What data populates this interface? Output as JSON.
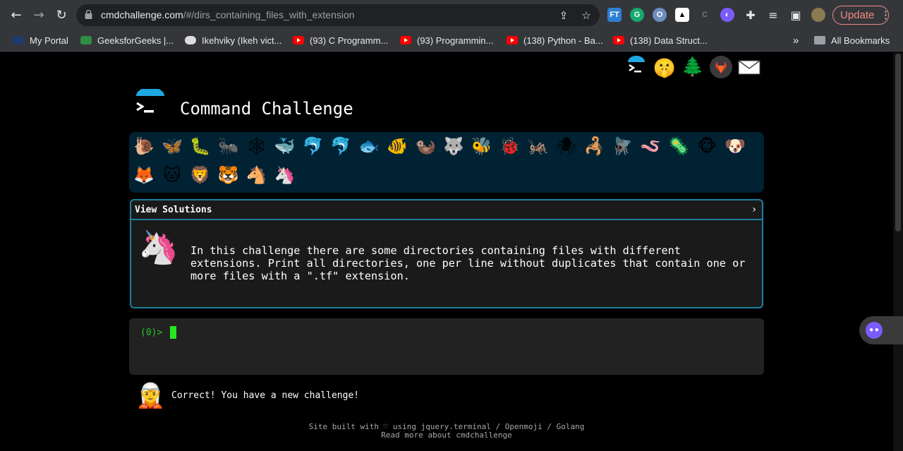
{
  "browser": {
    "url_host": "cmdchallenge.com",
    "url_path": "/#/dirs_containing_files_with_extension",
    "update_label": "Update",
    "extensions": [
      "FT",
      "G",
      "O",
      "▲",
      "C",
      "◐"
    ],
    "bookmarks": [
      {
        "label": "My Portal",
        "icon": "portal-icon"
      },
      {
        "label": "GeeksforGeeks |...",
        "icon": "geeksforgeeks-icon"
      },
      {
        "label": "Ikehviky (Ikeh vict...",
        "icon": "github-icon"
      },
      {
        "label": "(93) C Programm...",
        "icon": "youtube-icon"
      },
      {
        "label": "(93) Programmin...",
        "icon": "youtube-icon"
      },
      {
        "label": "(138) Python - Ba...",
        "icon": "youtube-icon"
      },
      {
        "label": "(138) Data Struct...",
        "icon": "youtube-icon"
      }
    ],
    "overflow_label": "»",
    "all_bookmarks_label": "All Bookmarks"
  },
  "header": {
    "top_icons": [
      "terminal-icon",
      "shushing-face-icon",
      "tree-icon",
      "gitlab-icon",
      "envelope-icon"
    ],
    "title": "Command Challenge"
  },
  "animals": [
    "🐌",
    "🦋",
    "🐛",
    "🐜",
    "🕸",
    "🐳",
    "🐬",
    "🐬",
    "🐟",
    "🐠",
    "🦦",
    "🐺",
    "🐝",
    "🐞",
    "🦗",
    "🕷",
    "🦂",
    "🪰",
    "🪱",
    "🦠",
    "🐵",
    "🐶",
    "🦊",
    "🐱",
    "🦁",
    "🐯",
    "🐴",
    "🦄"
  ],
  "solutions": {
    "header_label": "View Solutions",
    "chevron": "›",
    "text": "In this challenge there are some directories containing files with different extensions. Print all directories, one per line without duplicates that contain one or more files with a \".tf\" extension."
  },
  "terminal": {
    "prompt": "(0)>"
  },
  "message": {
    "text": "Correct! You have a new challenge!"
  },
  "footer": {
    "line1": "Site built with ♡ using jquery.terminal / Openmoji / Golang",
    "line2": "Read more about cmdchallenge"
  }
}
